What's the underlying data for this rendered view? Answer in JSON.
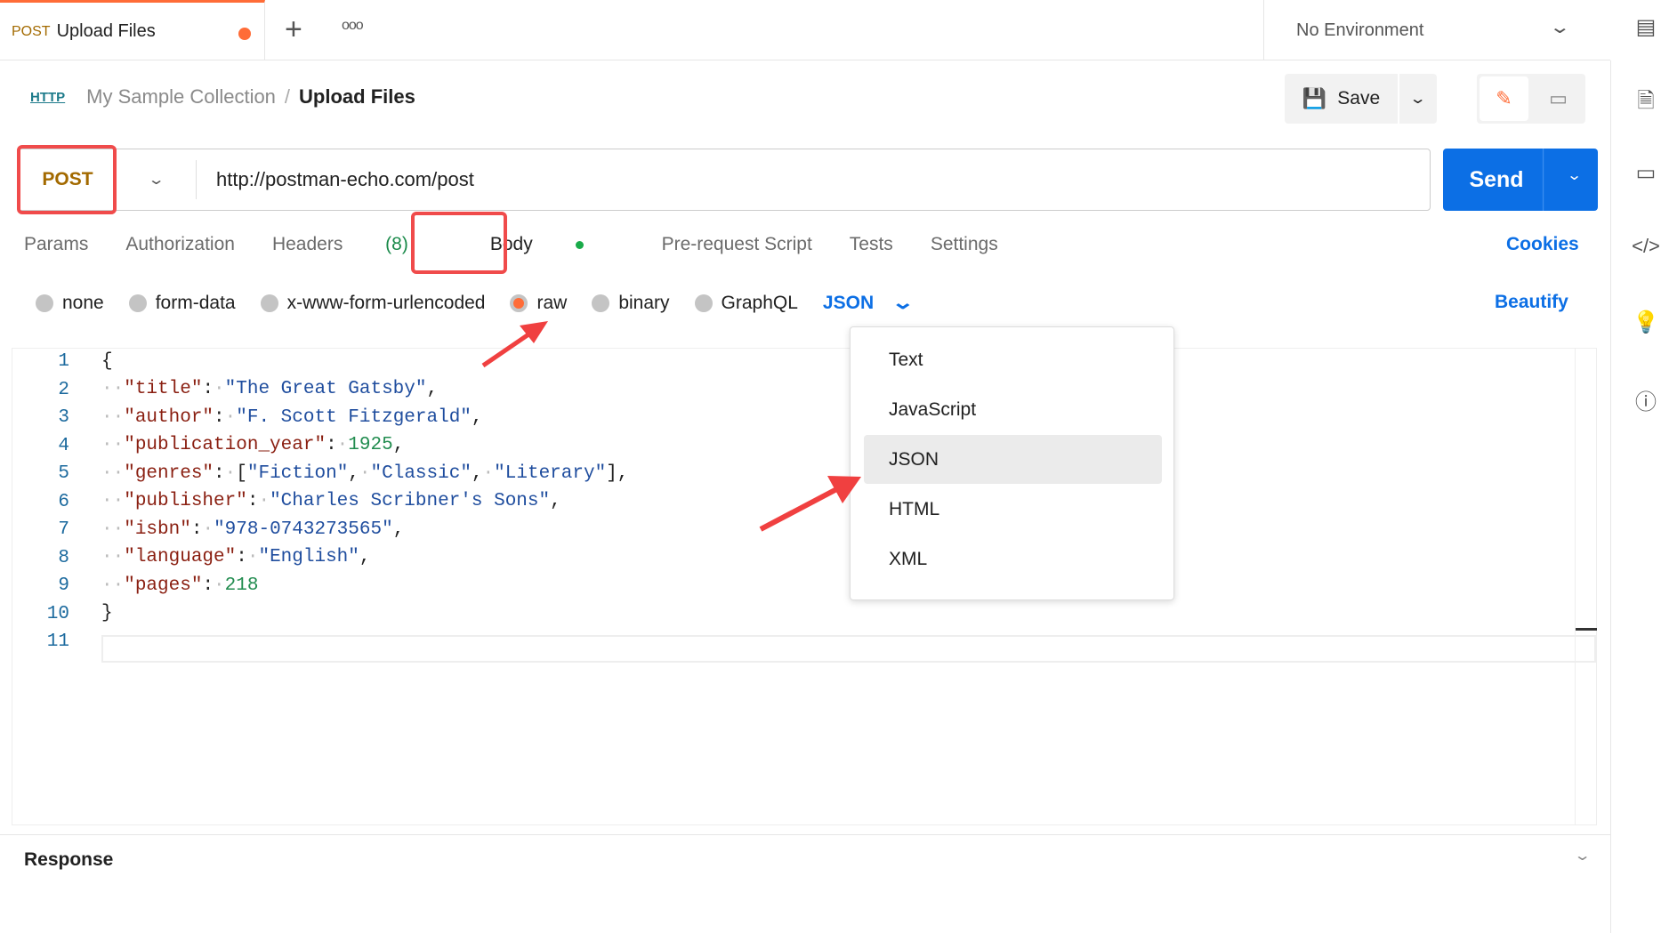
{
  "tab": {
    "method": "POST",
    "title": "Upload Files"
  },
  "environment": "No Environment",
  "breadcrumb": {
    "icon": "HTTP",
    "collection": "My Sample Collection",
    "sep": "/",
    "request": "Upload Files"
  },
  "toolbar": {
    "save": "Save"
  },
  "request": {
    "method": "POST",
    "url": "http://postman-echo.com/post",
    "send": "Send"
  },
  "tabs": {
    "params": "Params",
    "authorization": "Authorization",
    "headers": "Headers",
    "headers_count": "(8)",
    "body": "Body",
    "prerequest": "Pre-request Script",
    "tests": "Tests",
    "settings": "Settings",
    "cookies": "Cookies"
  },
  "body_types": {
    "none": "none",
    "form_data": "form-data",
    "urlencoded": "x-www-form-urlencoded",
    "raw": "raw",
    "binary": "binary",
    "graphql": "GraphQL",
    "selected": "raw",
    "format": "JSON",
    "beautify": "Beautify"
  },
  "code_lines": [
    "1",
    "2",
    "3",
    "4",
    "5",
    "6",
    "7",
    "8",
    "9",
    "10",
    "11"
  ],
  "code": {
    "open": "{",
    "title_k": "\"title\"",
    "title_v": "\"The Great Gatsby\"",
    "author_k": "\"author\"",
    "author_v": "\"F. Scott Fitzgerald\"",
    "year_k": "\"publication_year\"",
    "year_v": "1925",
    "genres_k": "\"genres\"",
    "g1": "\"Fiction\"",
    "g2": "\"Classic\"",
    "g3": "\"Literary\"",
    "pub_k": "\"publisher\"",
    "pub_v": "\"Charles Scribner's Sons\"",
    "isbn_k": "\"isbn\"",
    "isbn_v": "\"978-0743273565\"",
    "lang_k": "\"language\"",
    "lang_v": "\"English\"",
    "pages_k": "\"pages\"",
    "pages_v": "218",
    "close": "}"
  },
  "format_menu": {
    "items": [
      "Text",
      "JavaScript",
      "JSON",
      "HTML",
      "XML"
    ],
    "selected": "JSON"
  },
  "response": {
    "title": "Response"
  },
  "colors": {
    "accent": "#0c6fe5",
    "highlight": "#f04b4b",
    "tab_dot": "#ff6c37"
  }
}
